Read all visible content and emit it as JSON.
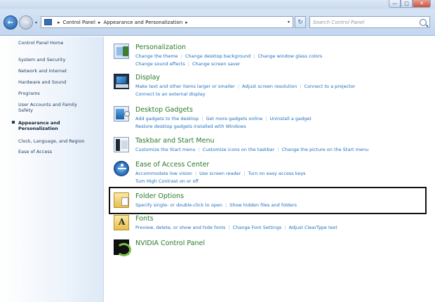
{
  "window": {
    "minimize_glyph": "—",
    "maximize_glyph": "□",
    "close_glyph": "✕"
  },
  "nav": {
    "back_glyph": "←",
    "forward_glyph": "→",
    "breadcrumb": [
      "Control Panel",
      "Appearance and Personalization"
    ],
    "refresh_glyph": "↻",
    "search_placeholder": "Search Control Panel"
  },
  "sidebar": {
    "home": "Control Panel Home",
    "items": [
      "System and Security",
      "Network and Internet",
      "Hardware and Sound",
      "Programs",
      "User Accounts and Family Safety",
      "Appearance and Personalization",
      "Clock, Language, and Region",
      "Ease of Access"
    ],
    "active_index": 5
  },
  "categories": [
    {
      "icon": "personalization-icon",
      "title": "Personalization",
      "links": [
        "Change the theme",
        "Change desktop background",
        "Change window glass colors",
        "Change sound effects",
        "Change screen saver"
      ]
    },
    {
      "icon": "display-icon",
      "title": "Display",
      "links": [
        "Make text and other items larger or smaller",
        "Adjust screen resolution",
        "Connect to a projector",
        "Connect to an external display"
      ]
    },
    {
      "icon": "desktop-gadgets-icon",
      "title": "Desktop Gadgets",
      "links": [
        "Add gadgets to the desktop",
        "Get more gadgets online",
        "Uninstall a gadget",
        "Restore desktop gadgets installed with Windows"
      ]
    },
    {
      "icon": "taskbar-icon",
      "title": "Taskbar and Start Menu",
      "links": [
        "Customize the Start menu",
        "Customize icons on the taskbar",
        "Change the picture on the Start menu"
      ]
    },
    {
      "icon": "ease-of-access-icon",
      "title": "Ease of Access Center",
      "links": [
        "Accommodate low vision",
        "Use screen reader",
        "Turn on easy access keys",
        "Turn High Contrast on or off"
      ]
    },
    {
      "icon": "folder-options-icon",
      "title": "Folder Options",
      "links": [
        "Specify single- or double-click to open",
        "Show hidden files and folders"
      ]
    },
    {
      "icon": "fonts-icon",
      "title": "Fonts",
      "links": [
        "Preview, delete, or show and hide fonts",
        "Change Font Settings",
        "Adjust ClearType text"
      ]
    },
    {
      "icon": "nvidia-icon",
      "title": "NVIDIA Control Panel",
      "links": []
    }
  ],
  "colors": {
    "link": "#1f6fbf",
    "category_title": "#2a7a2a",
    "highlight_border": "#111111"
  }
}
